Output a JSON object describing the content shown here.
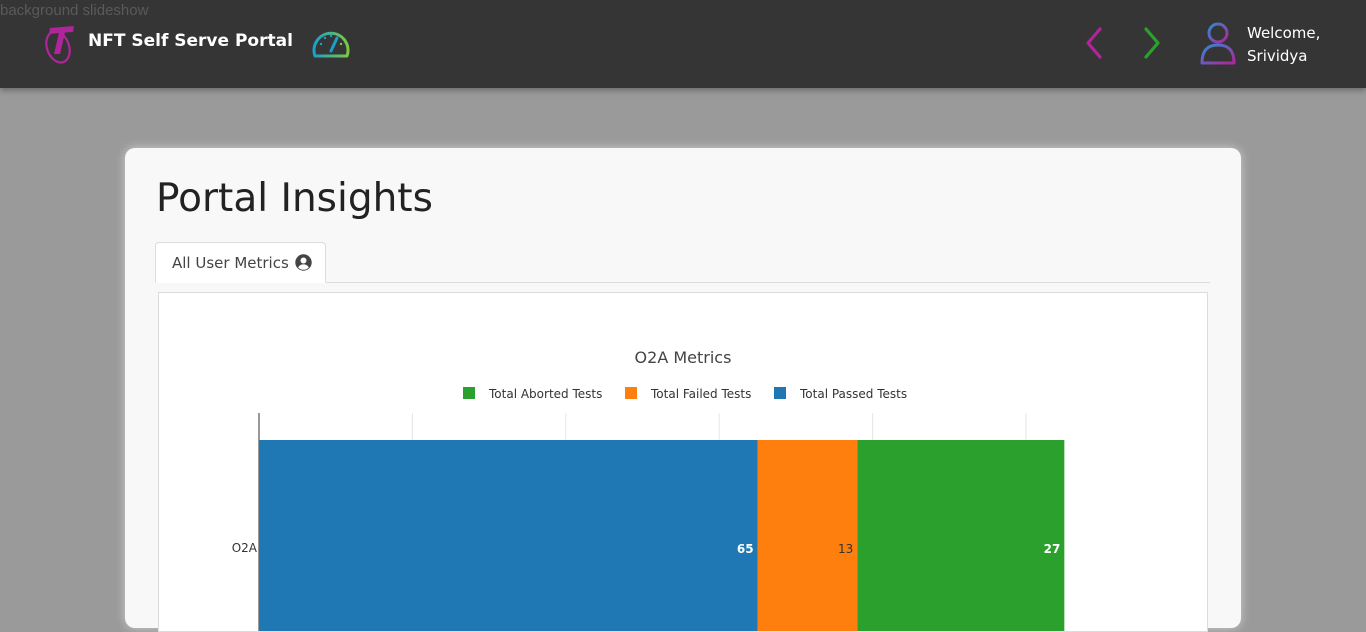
{
  "broken_image_alt": "background slideshow",
  "header": {
    "brand": "NFT Self Serve Portal",
    "logo_icon": "telstra-t-logo-icon",
    "dashboard_icon": "speedometer-icon",
    "back_icon": "chevron-left-icon",
    "forward_icon": "chevron-right-icon",
    "user_icon": "user-avatar-icon",
    "welcome_line1": "Welcome,",
    "welcome_line2": "Srividya"
  },
  "page": {
    "title": "Portal Insights",
    "tabs": [
      {
        "label": "All User Metrics",
        "icon": "user-circle-icon"
      }
    ]
  },
  "colors": {
    "topbar": "#353535",
    "aborted": "#2ca02c",
    "failed": "#ff7f0e",
    "passed": "#1f77b4",
    "back_arrow": "#b0259b",
    "forward_arrow": "#2ca02c"
  },
  "chart_data": {
    "type": "bar",
    "orientation": "horizontal",
    "stacked": true,
    "title": "O2A Metrics",
    "categories": [
      "O2A"
    ],
    "legend_position": "top",
    "legend": [
      "Total Aborted Tests",
      "Total Failed Tests",
      "Total Passed Tests"
    ],
    "series": [
      {
        "name": "Total Passed Tests",
        "values": [
          65
        ],
        "color": "#1f77b4"
      },
      {
        "name": "Total Failed Tests",
        "values": [
          13
        ],
        "color": "#ff7f0e"
      },
      {
        "name": "Total Aborted Tests",
        "values": [
          27
        ],
        "color": "#2ca02c"
      }
    ],
    "xlim": [
      0,
      120
    ],
    "grid": true
  }
}
